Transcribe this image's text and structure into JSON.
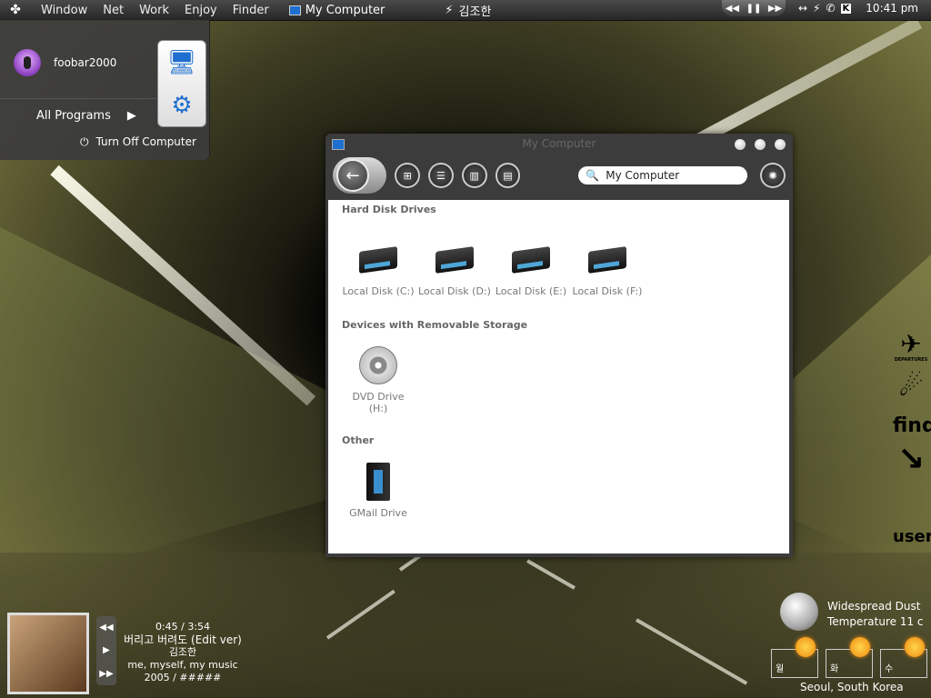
{
  "menubar": {
    "items": [
      "Window",
      "Net",
      "Work",
      "Enjoy",
      "Finder"
    ],
    "active_window": "My Computer",
    "now_playing": "김조한",
    "clock": "10:41 pm"
  },
  "start_menu": {
    "username": "foobar2000",
    "all_programs": "All Programs",
    "turn_off": "Turn Off Computer"
  },
  "window": {
    "title": "My Computer",
    "search_value": "My Computer",
    "groups": {
      "hdd": "Hard Disk Drives",
      "removable": "Devices with Removable Storage",
      "other": "Other"
    },
    "drives": [
      "Local Disk (C:)",
      "Local Disk (D:)",
      "Local Disk (E:)",
      "Local Disk (F:)"
    ],
    "dvd": "DVD Drive (H:)",
    "gmail": "GMail Drive"
  },
  "sidebar": {
    "departures": "DEPARTURES",
    "find": "find",
    "user": "user"
  },
  "player": {
    "time": "0:45 / 3:54",
    "title": "버리고 버려도 (Edit ver)",
    "artist": "김조한",
    "album": "me, myself, my music",
    "year": "2005 / #####"
  },
  "weather": {
    "condition": "Widespread Dust",
    "temperature": "Temperature 11 c",
    "days": [
      "월",
      "화",
      "수"
    ],
    "city": "Seoul, South Korea"
  }
}
